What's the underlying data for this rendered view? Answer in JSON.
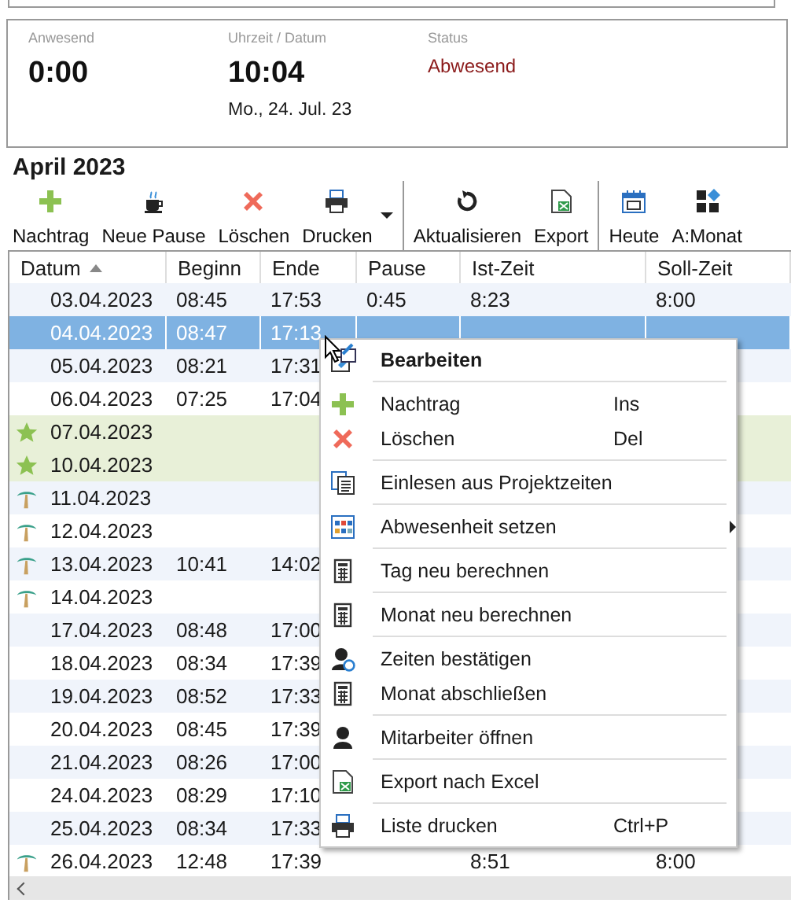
{
  "summary": {
    "fields": [
      {
        "label": "Anwesend",
        "value": "0:00"
      },
      {
        "label": "Uhrzeit / Datum",
        "value": "10:04",
        "note": "Mo., 24. Jul. 23"
      },
      {
        "label": "Status",
        "status": "Abwesend"
      }
    ]
  },
  "month_title": "April 2023",
  "toolbar": [
    {
      "label": "Nachtrag"
    },
    {
      "label": "Neue Pause"
    },
    {
      "label": "Löschen"
    },
    {
      "label": "Drucken",
      "dropdown": true
    },
    {
      "kind": "separator"
    },
    {
      "label": "Aktualisieren"
    },
    {
      "label": "Export"
    },
    {
      "kind": "separator"
    },
    {
      "label": "Heute"
    },
    {
      "label": "A:Monat"
    }
  ],
  "table": {
    "columns": [
      {
        "label": "Datum",
        "sorted": true
      },
      {
        "label": "Beginn",
        "sorted": false
      },
      {
        "label": "Ende",
        "sorted": false
      },
      {
        "label": "Pause",
        "sorted": false
      },
      {
        "label": "Ist-Zeit",
        "sorted": false
      },
      {
        "label": "Soll-Zeit",
        "sorted": false
      }
    ],
    "rows": [
      {
        "kind": "normal",
        "selected": false,
        "cells": [
          "03.04.2023",
          "08:45",
          "17:53",
          "0:45",
          "8:23",
          "8:00"
        ]
      },
      {
        "kind": "normal",
        "selected": true,
        "cells": [
          "04.04.2023",
          "08:47",
          "17:13"
        ]
      },
      {
        "kind": "normal",
        "selected": false,
        "cells": [
          "05.04.2023",
          "08:21",
          "17:31"
        ]
      },
      {
        "kind": "normal",
        "selected": false,
        "cells": [
          "06.04.2023",
          "07:25",
          "17:04"
        ]
      },
      {
        "kind": "holiday",
        "selected": false,
        "cells": [
          "07.04.2023"
        ]
      },
      {
        "kind": "holiday",
        "selected": false,
        "cells": [
          "10.04.2023"
        ]
      },
      {
        "kind": "vacation",
        "selected": false,
        "cells": [
          "11.04.2023"
        ]
      },
      {
        "kind": "vacation",
        "selected": false,
        "cells": [
          "12.04.2023"
        ]
      },
      {
        "kind": "vacation",
        "selected": false,
        "cells": [
          "13.04.2023",
          "10:41",
          "14:02"
        ]
      },
      {
        "kind": "vacation",
        "selected": false,
        "cells": [
          "14.04.2023"
        ]
      },
      {
        "kind": "normal",
        "selected": false,
        "cells": [
          "17.04.2023",
          "08:48",
          "17:00"
        ]
      },
      {
        "kind": "normal",
        "selected": false,
        "cells": [
          "18.04.2023",
          "08:34",
          "17:39"
        ]
      },
      {
        "kind": "normal",
        "selected": false,
        "cells": [
          "19.04.2023",
          "08:52",
          "17:33"
        ]
      },
      {
        "kind": "normal",
        "selected": false,
        "cells": [
          "20.04.2023",
          "08:45",
          "17:39"
        ]
      },
      {
        "kind": "normal",
        "selected": false,
        "cells": [
          "21.04.2023",
          "08:26",
          "17:00"
        ]
      },
      {
        "kind": "normal",
        "selected": false,
        "cells": [
          "24.04.2023",
          "08:29",
          "17:10"
        ]
      },
      {
        "kind": "normal",
        "selected": false,
        "cells": [
          "25.04.2023",
          "08:34",
          "17:33"
        ]
      },
      {
        "kind": "vacation",
        "selected": false,
        "cells": [
          "26.04.2023",
          "12:48",
          "17:39",
          "",
          "8:51",
          "8:00"
        ]
      }
    ]
  },
  "context_menu": {
    "groups": [
      [
        {
          "label": "Bearbeiten",
          "bold": true
        }
      ],
      [
        {
          "label": "Nachtrag",
          "shortcut": "Ins"
        },
        {
          "label": "Löschen",
          "shortcut": "Del"
        }
      ],
      [
        {
          "label": "Einlesen aus Projektzeiten"
        }
      ],
      [
        {
          "label": "Abwesenheit setzen",
          "submenu": true
        }
      ],
      [
        {
          "label": "Tag neu berechnen"
        }
      ],
      [
        {
          "label": "Monat neu berechnen"
        }
      ],
      [
        {
          "label": "Zeiten bestätigen"
        },
        {
          "label": "Monat abschließen"
        }
      ],
      [
        {
          "label": "Mitarbeiter öffnen"
        }
      ],
      [
        {
          "label": "Export nach Excel"
        }
      ],
      [
        {
          "label": "Liste drucken",
          "shortcut": "Ctrl+P"
        }
      ]
    ]
  }
}
